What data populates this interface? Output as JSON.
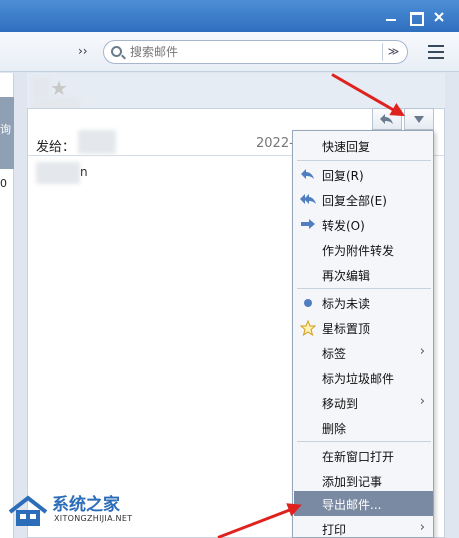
{
  "toolbar": {
    "more_glyph": "››",
    "search_placeholder": "搜索邮件",
    "search_dropdown_glyph": "≫",
    "list_view_icon": "list-view-icon"
  },
  "left_pane": {
    "char_1": "询",
    "char_2": "0"
  },
  "message": {
    "to_label": "发给：",
    "date_text": "2022-",
    "body_text": "n"
  },
  "menu": {
    "items": [
      {
        "label": "快速回复",
        "icon": ""
      },
      {
        "label": "回复(R)",
        "icon": "reply-icon"
      },
      {
        "label": "回复全部(E)",
        "icon": "reply-all-icon"
      },
      {
        "label": "转发(O)",
        "icon": "forward-icon"
      },
      {
        "label": "作为附件转发",
        "icon": ""
      },
      {
        "label": "再次编辑",
        "icon": ""
      },
      {
        "label": "标为未读",
        "icon": "unread-dot-icon"
      },
      {
        "label": "星标置顶",
        "icon": "star-icon"
      },
      {
        "label": "标签",
        "icon": "",
        "submenu": true
      },
      {
        "label": "标为垃圾邮件",
        "icon": ""
      },
      {
        "label": "移动到",
        "icon": "",
        "submenu": true
      },
      {
        "label": "删除",
        "icon": ""
      },
      {
        "label": "在新窗口打开",
        "icon": ""
      },
      {
        "label": "添加到记事",
        "icon": ""
      },
      {
        "label": "导出邮件...",
        "icon": "",
        "highlighted": true
      },
      {
        "label": "打印",
        "icon": "",
        "submenu": true
      }
    ],
    "highlight_color": "#7a8aa2"
  },
  "watermark": {
    "title": "系统之家",
    "subtitle": "XITONGZHIJIA.NET"
  },
  "colors": {
    "titlebar": "#2f6fbf",
    "arrow": "#e0221f"
  }
}
